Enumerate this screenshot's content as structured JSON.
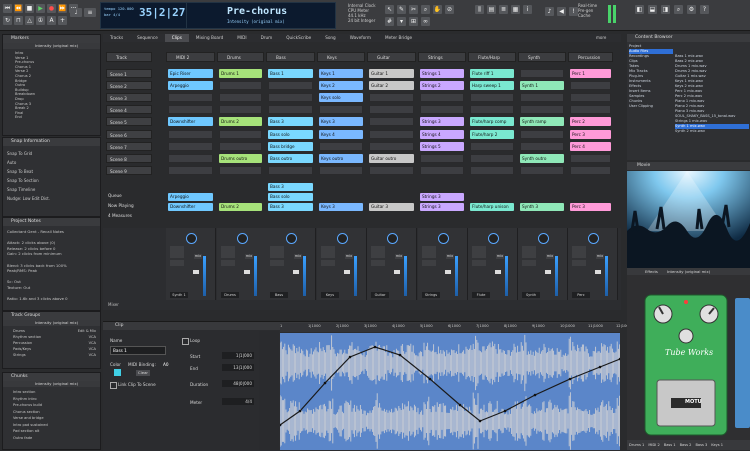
{
  "toolbar": {
    "counter": "35|2|273",
    "counter_sub": "tempo 120.000",
    "counter_sub2": "bar 4/4",
    "song_name": "Pre-chorus",
    "song_sub": "Intensity (original mix)",
    "sync_lines": [
      "Internal Clock",
      "CPU Meter",
      "44.1 kHz",
      "24 bit Integer"
    ],
    "right_lines": [
      "Real-time",
      "Pre-gen",
      "Cache"
    ]
  },
  "markers": {
    "title": "Markers",
    "dropdown": "Intensity (original mix)",
    "rows": [
      "Intro",
      "Verse 1",
      "Pre-chorus",
      "Chorus 1",
      "Verse 2",
      "Chorus 2",
      "Bridge",
      "Outro",
      "Buildup",
      "Breakdown",
      "Drop",
      "Chorus 3",
      "Break 2",
      "Final",
      "End"
    ]
  },
  "snap": {
    "title": "Snap Information",
    "items": [
      "Snap To Grid",
      "Auto",
      "Snap To Beat",
      "Snap To Section",
      "Snap Timeline",
      "Nudge: Low Edit Dist."
    ]
  },
  "notes": {
    "title": "Project Notes",
    "lines": [
      "Collectant Gent - Recall Notes",
      "",
      "Attack: 2 clicks above (0)",
      "Release: 2 clicks before 0",
      "Gain: 2 clicks from minimum",
      "",
      "Blend: 3 clicks back from 100%",
      "Peak/RMS: Peak",
      "",
      "Sc: Out",
      "Texture: Out",
      "",
      "Ratio: 1.6k and 3 clicks above 0"
    ]
  },
  "groups": {
    "title": "Track Groups",
    "dropdown": "Intensity (original mix)",
    "rows": [
      "Drums",
      "Rhythm section",
      "Percussion",
      "Pads/Keys",
      "Strings"
    ],
    "values": [
      "Edit & Mix",
      "VCA",
      "VCA",
      "VCA",
      "VCA"
    ]
  },
  "chunks": {
    "title": "Chunks",
    "dropdown": "Intensity (original mix)",
    "rows": [
      "Intro section",
      "Rhythm intro",
      "Pre-chorus build",
      "Chorus section",
      "Verse and bridge",
      "Intro pad sustained",
      "Pad section alt",
      "Outro fade"
    ]
  },
  "tabs": [
    "Tracks",
    "Sequence",
    "Clips",
    "Mixing Board",
    "MIDI",
    "Drum",
    "QuickScribe",
    "Song",
    "Waveform",
    "Meter Bridge"
  ],
  "tabs_extra": "more",
  "columns": [
    "Track",
    "MIDI 2",
    "Drums",
    "Bass",
    "Keys",
    "Guitar",
    "Strings",
    "Flute/Harp",
    "Synth",
    "Percussion"
  ],
  "scenes": [
    "Scene 1",
    "Scene 2",
    "Scene 3",
    "Scene 4",
    "Scene 5",
    "Scene 6",
    "Scene 7",
    "Scene 8",
    "Scene 9"
  ],
  "grid_status": [
    "Queue",
    "Now Playing",
    "4 Measures"
  ],
  "clips": [
    {
      "c": 1,
      "r": 0,
      "t": "Epic Riser",
      "col": "#6fc8ff"
    },
    {
      "c": 1,
      "r": 1,
      "t": "Arpeggio",
      "col": "#6fc8ff"
    },
    {
      "c": 1,
      "r": 4,
      "t": "Downshifter",
      "col": "#6fc8ff"
    },
    {
      "c": 2,
      "r": 0,
      "t": "Drums 1",
      "col": "#a6e27a"
    },
    {
      "c": 2,
      "r": 4,
      "t": "Drums 2",
      "col": "#a6e27a"
    },
    {
      "c": 2,
      "r": 7,
      "t": "Drums outro",
      "col": "#a6e27a"
    },
    {
      "c": 3,
      "r": 0,
      "t": "Bass 1",
      "col": "#7ad8ff"
    },
    {
      "c": 3,
      "r": 4,
      "t": "Bass 3",
      "col": "#7ad8ff"
    },
    {
      "c": 3,
      "r": 5,
      "t": "Bass solo",
      "col": "#7ad8ff"
    },
    {
      "c": 3,
      "r": 6,
      "t": "Bass bridge",
      "col": "#7ad8ff"
    },
    {
      "c": 3,
      "r": 7,
      "t": "Bass outro",
      "col": "#7ad8ff"
    },
    {
      "c": 4,
      "r": 0,
      "t": "Keys 1",
      "col": "#7ab8ff"
    },
    {
      "c": 4,
      "r": 1,
      "t": "Keys 2",
      "col": "#7ab8ff"
    },
    {
      "c": 4,
      "r": 2,
      "t": "Keys solo",
      "col": "#7ab8ff"
    },
    {
      "c": 4,
      "r": 4,
      "t": "Keys 3",
      "col": "#7ab8ff"
    },
    {
      "c": 4,
      "r": 5,
      "t": "Keys 4",
      "col": "#7ab8ff"
    },
    {
      "c": 4,
      "r": 7,
      "t": "Keys outro",
      "col": "#7ab8ff"
    },
    {
      "c": 5,
      "r": 0,
      "t": "Guitar 1",
      "col": "#c8c8c8"
    },
    {
      "c": 5,
      "r": 1,
      "t": "Guitar 2",
      "col": "#c8c8c8"
    },
    {
      "c": 5,
      "r": 7,
      "t": "Guitar outro",
      "col": "#c8c8c8"
    },
    {
      "c": 6,
      "r": 0,
      "t": "Strings 1",
      "col": "#c9a8ff"
    },
    {
      "c": 6,
      "r": 1,
      "t": "Strings 2",
      "col": "#c9a8ff"
    },
    {
      "c": 6,
      "r": 4,
      "t": "Strings 3",
      "col": "#c9a8ff"
    },
    {
      "c": 6,
      "r": 5,
      "t": "Strings 4",
      "col": "#c9a8ff"
    },
    {
      "c": 6,
      "r": 6,
      "t": "Strings 5",
      "col": "#c9a8ff"
    },
    {
      "c": 7,
      "r": 0,
      "t": "Flute riff 1",
      "col": "#7ae8d0"
    },
    {
      "c": 7,
      "r": 1,
      "t": "Harp sweep 1",
      "col": "#7ae8d0"
    },
    {
      "c": 7,
      "r": 4,
      "t": "Flute/harp comp",
      "col": "#7ae8d0"
    },
    {
      "c": 7,
      "r": 5,
      "t": "Flute/harp 2",
      "col": "#7ae8d0"
    },
    {
      "c": 8,
      "r": 1,
      "t": "Synth 1",
      "col": "#8fe8b8"
    },
    {
      "c": 8,
      "r": 4,
      "t": "Synth ramp",
      "col": "#8fe8b8"
    },
    {
      "c": 8,
      "r": 7,
      "t": "Synth outro",
      "col": "#8fe8b8"
    },
    {
      "c": 9,
      "r": 0,
      "t": "Perc 1",
      "col": "#ff9ad8"
    },
    {
      "c": 9,
      "r": 4,
      "t": "Perc 2",
      "col": "#ff9ad8"
    },
    {
      "c": 9,
      "r": 5,
      "t": "Perc 3",
      "col": "#ff9ad8"
    },
    {
      "c": 9,
      "r": 6,
      "t": "Perc 4",
      "col": "#ff9ad8"
    }
  ],
  "queue_clips": [
    {
      "c": 1,
      "r": 0,
      "t": "Arpeggio",
      "col": "#6fc8ff"
    },
    {
      "c": 1,
      "r": 1,
      "t": "Downshifter",
      "col": "#6fc8ff"
    },
    {
      "c": 2,
      "r": 1,
      "t": "Drums 2",
      "col": "#a6e27a"
    },
    {
      "c": 3,
      "r": -1,
      "t": "Bass 3",
      "col": "#7ad8ff"
    },
    {
      "c": 3,
      "r": 0,
      "t": "Bass solo",
      "col": "#7ad8ff"
    },
    {
      "c": 3,
      "r": 1,
      "t": "Bass 3",
      "col": "#7ad8ff"
    },
    {
      "c": 4,
      "r": 1,
      "t": "Keys 3",
      "col": "#7ab8ff"
    },
    {
      "c": 5,
      "r": 1,
      "t": "Guitar 3",
      "col": "#c8c8c8"
    },
    {
      "c": 6,
      "r": 0,
      "t": "Strings 3",
      "col": "#c9a8ff"
    },
    {
      "c": 6,
      "r": 1,
      "t": "Strings 3",
      "col": "#c9a8ff"
    },
    {
      "c": 7,
      "r": 1,
      "t": "Flute/harp unison",
      "col": "#7ae8d0"
    },
    {
      "c": 8,
      "r": 1,
      "t": "Synth 3",
      "col": "#8fe8b8"
    },
    {
      "c": 9,
      "r": 1,
      "t": "Perc 3",
      "col": "#ff9ad8"
    }
  ],
  "mixer": {
    "label": "Mixer",
    "channels": [
      "Synth 1",
      "Drums",
      "Bass",
      "Keys",
      "Guitar",
      "Strings",
      "Flute",
      "Synth",
      "Perc"
    ],
    "mix_label": "mix",
    "master_label": "Master"
  },
  "clip_panel": {
    "title": "Clip",
    "name_label": "Name",
    "name_value": "Bass 1",
    "color_label": "Color",
    "midi_label": "MIDI Binding:",
    "midi_value": "A0",
    "clear_label": "Clear",
    "link_label": "Link Clip To Scene",
    "loop_label": "Loop",
    "start_label": "Start",
    "start_value": "1|1|000",
    "end_label": "End",
    "end_value": "13|1|000",
    "duration_label": "Duration",
    "duration_value": "48|0|000",
    "meter_label": "Meter",
    "meter_value": "4/4",
    "ruler": [
      "1",
      "1|1000",
      "2|1000",
      "3|1000",
      "4|1000",
      "5|1000",
      "6|1000",
      "7|1000",
      "8|1000",
      "9|1000",
      "10|1000",
      "11|1000",
      "12|1000"
    ]
  },
  "browser": {
    "title": "Content Browser",
    "tree": [
      "Project",
      "Audio Files",
      "Recordings",
      "Clips",
      "Takes",
      "Mix Tracks",
      "Plug-ins",
      "Instruments",
      "Effects",
      "Insert Items",
      "Samples",
      "Chunks",
      "User Clipping"
    ],
    "files": [
      "Bass 1 mix.wav",
      "Bass 2 mix.wav",
      "Drums 1 mix.wav",
      "Drums 2 mix.wav",
      "Guitar 1 mix.wav",
      "Keys 1 mix.wav",
      "Keys 2 mix.wav",
      "Perc 1 mix.wav",
      "Perc 2 mix.wav",
      "Piano 1 mix.wav",
      "Piano 2 mix.wav",
      "Piano 3 mix.wav",
      "SOUL_SHAKY_BASS_15_tonal.wav",
      "Strings 1 mix.wav",
      "Synth 1 mix.wav",
      "Synth 2 mix.wav"
    ],
    "selected": "Audio Files"
  },
  "movie": {
    "title": "Movie"
  },
  "pedal": {
    "effects_label": "Effects",
    "dropdown": "Intensity (original mix)",
    "brand": "Tube Works",
    "maker": "MOTU",
    "bottom_tabs": [
      "Drums 1",
      "MIDI 2",
      "Bass 1",
      "Bass 2",
      "Bass 3",
      "Keys 1"
    ]
  },
  "colors": {
    "accent": "#3a9cff",
    "wave": "#5b86c9",
    "pedal": "#3fae5a"
  }
}
